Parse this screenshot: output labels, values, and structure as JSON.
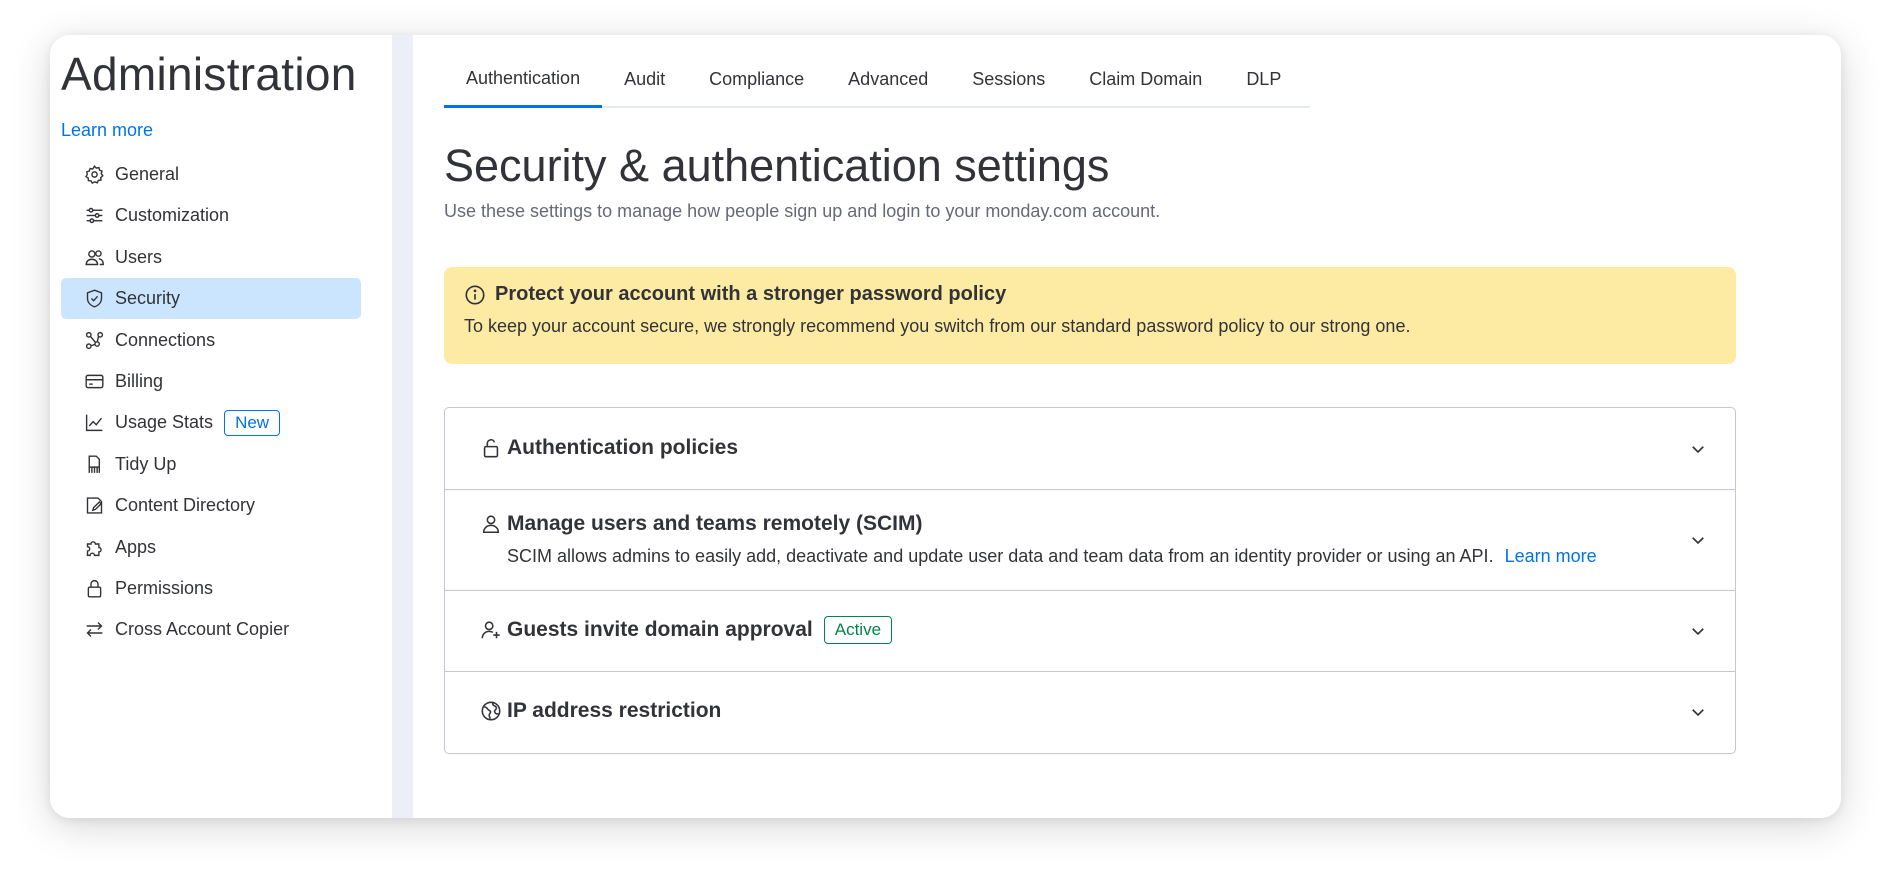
{
  "sidebar": {
    "title": "Administration",
    "learn_more": "Learn more",
    "items": [
      {
        "label": "General",
        "icon": "gear-icon"
      },
      {
        "label": "Customization",
        "icon": "sliders-icon"
      },
      {
        "label": "Users",
        "icon": "users-icon"
      },
      {
        "label": "Security",
        "icon": "shield-icon",
        "active": true
      },
      {
        "label": "Connections",
        "icon": "connections-icon"
      },
      {
        "label": "Billing",
        "icon": "credit-card-icon"
      },
      {
        "label": "Usage Stats",
        "icon": "chart-line-icon",
        "badge": "New"
      },
      {
        "label": "Tidy Up",
        "icon": "broom-icon"
      },
      {
        "label": "Content Directory",
        "icon": "directory-icon"
      },
      {
        "label": "Apps",
        "icon": "puzzle-icon"
      },
      {
        "label": "Permissions",
        "icon": "lock-icon"
      },
      {
        "label": "Cross Account Copier",
        "icon": "arrows-swap-icon"
      }
    ]
  },
  "tabs": [
    {
      "label": "Authentication",
      "active": true
    },
    {
      "label": "Audit"
    },
    {
      "label": "Compliance"
    },
    {
      "label": "Advanced"
    },
    {
      "label": "Sessions"
    },
    {
      "label": "Claim Domain"
    },
    {
      "label": "DLP"
    }
  ],
  "main": {
    "title": "Security & authentication settings",
    "subtitle": "Use these settings to manage how people sign up and login to your monday.com account."
  },
  "alert": {
    "title": "Protect your account with a stronger password policy",
    "text": "To keep your account secure, we strongly recommend you switch from our standard password policy to our strong one.",
    "icon": "info-icon"
  },
  "sections": [
    {
      "label": "Authentication policies",
      "icon": "unlock-icon"
    },
    {
      "label": "Manage users and teams remotely (SCIM)",
      "icon": "user-icon",
      "description": "SCIM allows admins to easily add, deactivate and update user data and team data from an identity provider or using an API.",
      "link": "Learn more"
    },
    {
      "label": "Guests invite domain approval",
      "icon": "user-add-icon",
      "badge": "Active"
    },
    {
      "label": "IP address restriction",
      "icon": "globe-icon"
    }
  ],
  "colors": {
    "accent": "#0073ea",
    "active_nav_bg": "#cce5ff",
    "alert_bg": "#fdeba4",
    "success": "#00854d",
    "text": "#323338"
  }
}
